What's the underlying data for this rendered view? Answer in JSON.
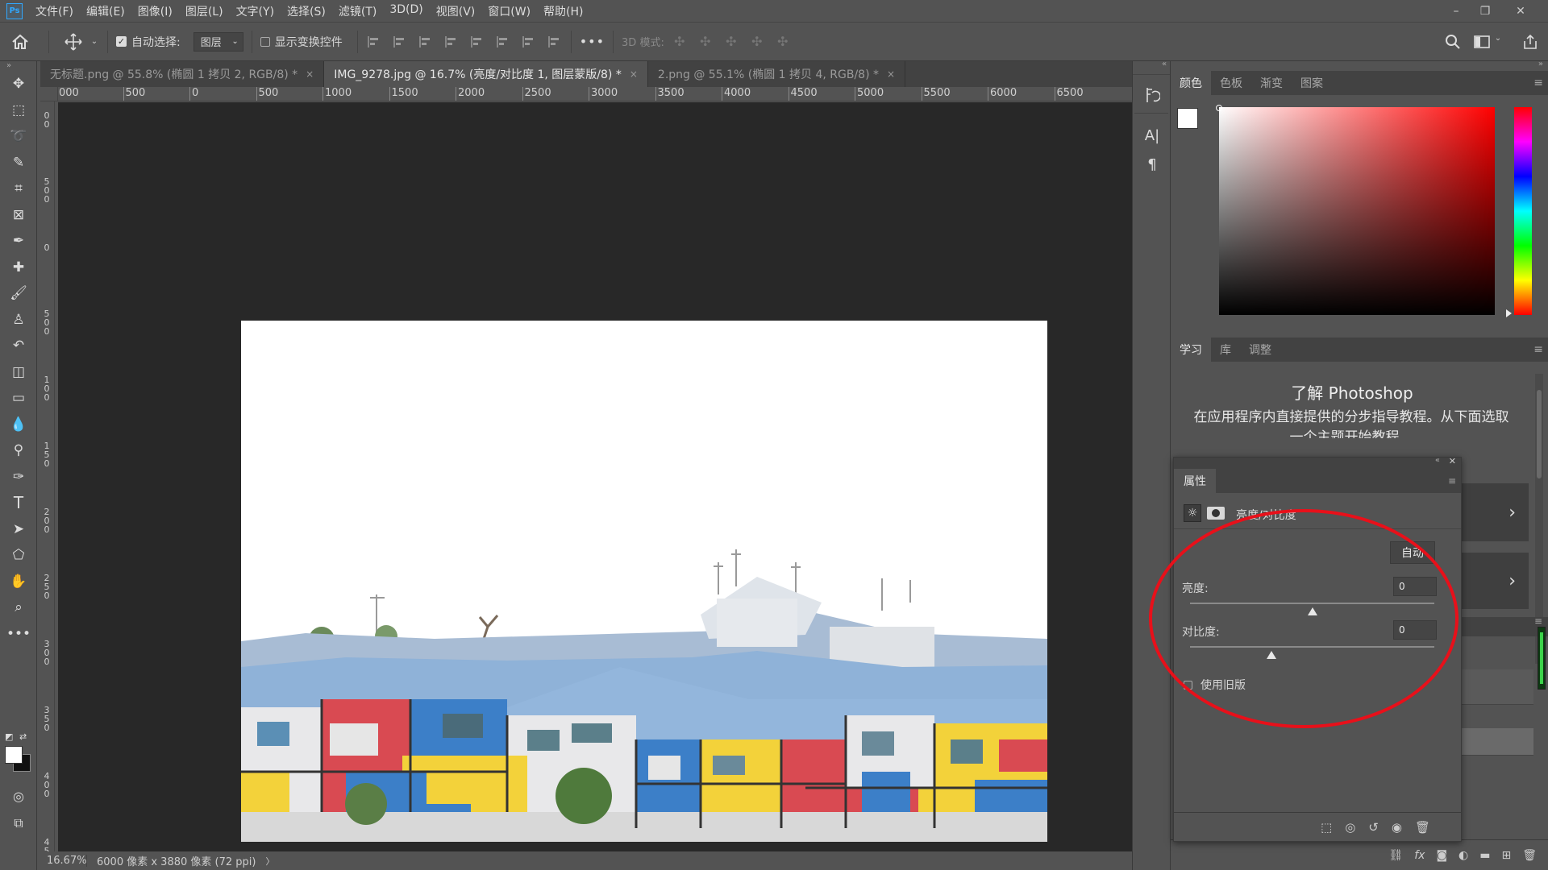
{
  "menubar": {
    "app_icon": "Ps",
    "items": [
      "文件(F)",
      "编辑(E)",
      "图像(I)",
      "图层(L)",
      "文字(Y)",
      "选择(S)",
      "滤镜(T)",
      "3D(D)",
      "视图(V)",
      "窗口(W)",
      "帮助(H)"
    ]
  },
  "options": {
    "auto_select_label": "自动选择:",
    "auto_select_checked": true,
    "layer_select_value": "图层",
    "show_transform_label": "显示变换控件",
    "more": "•••",
    "mode_3d_label": "3D 模式:"
  },
  "tabs": [
    {
      "label": "无标题.png @ 55.8% (椭圆 1 拷贝 2, RGB/8) *",
      "active": false
    },
    {
      "label": "IMG_9278.jpg @ 16.7% (亮度/对比度 1, 图层蒙版/8) *",
      "active": true
    },
    {
      "label": "2.png @ 55.1% (椭圆 1 拷贝 4, RGB/8) *",
      "active": false
    }
  ],
  "ruler_h": [
    "000",
    "500",
    "0",
    "500",
    "1000",
    "1500",
    "2000",
    "2500",
    "3000",
    "3500",
    "4000",
    "4500",
    "5000",
    "5500",
    "6000",
    "6500"
  ],
  "ruler_v": [
    "00",
    "500",
    "0",
    "500",
    "100",
    "150",
    "200",
    "250",
    "300",
    "350",
    "400",
    "45"
  ],
  "status": {
    "zoom": "16.67%",
    "doc_info": "6000 像素 x 3880 像素 (72 ppi)",
    "arrow": "〉"
  },
  "color_panel": {
    "tabs": [
      "颜色",
      "色板",
      "渐变",
      "图案"
    ],
    "active_tab": 0,
    "hue_color": "#ff0000"
  },
  "learn_panel": {
    "tabs": [
      "学习",
      "库",
      "调整"
    ],
    "active_tab": 0,
    "title": "了解 Photoshop",
    "description": "在应用程序内直接提供的分步指导教程。从下面选取一个主题开始教程。"
  },
  "properties": {
    "title": "属性",
    "adjustment_name": "亮度/对比度",
    "auto_button": "自动",
    "brightness_label": "亮度:",
    "brightness_value": "0",
    "contrast_label": "对比度:",
    "contrast_value": "0",
    "use_legacy_label": "使用旧版",
    "use_legacy_checked": false
  },
  "colors": {
    "annotation_oval": "#e8101a",
    "canvas_bg": "#282828",
    "panel_bg": "#535353"
  }
}
